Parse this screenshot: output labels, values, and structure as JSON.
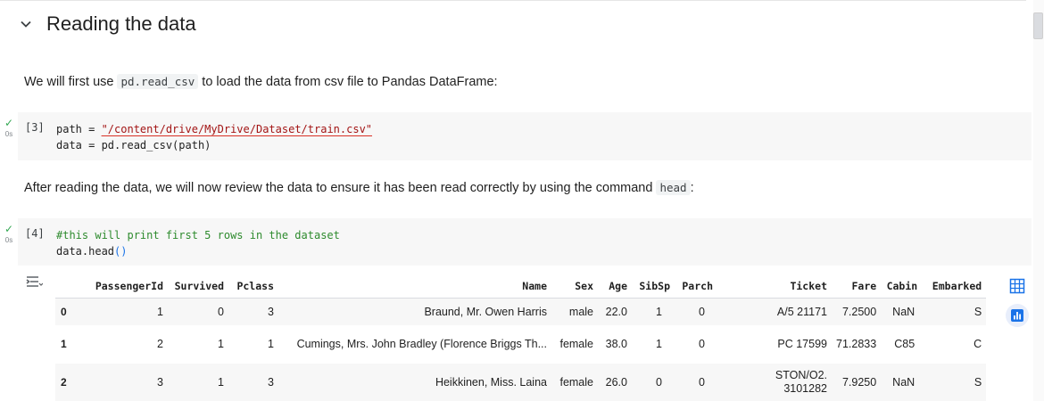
{
  "section": {
    "title": "Reading the data"
  },
  "text_cell_1": {
    "before": "We will first use ",
    "code": "pd.read_csv",
    "after": " to load the data from csv file to Pandas DataFrame:"
  },
  "cell_3": {
    "exec_count": "[3]",
    "exec_time": "0s",
    "line1_prefix": "path = ",
    "line1_string": "\"/content/drive/MyDrive/Dataset/train.csv\"",
    "line2": "data = pd.read_csv(path)"
  },
  "text_cell_2": {
    "before": "After reading the data, we will now review the data to ensure it has been read correctly by using the command ",
    "code": "head",
    "after": ":"
  },
  "cell_4": {
    "exec_count": "[4]",
    "exec_time": "0s",
    "comment": "#this will print first 5 rows in the dataset",
    "line2_prefix": "data.head",
    "line2_parens": "()"
  },
  "dataframe": {
    "columns": [
      "",
      "PassengerId",
      "Survived",
      "Pclass",
      "Name",
      "Sex",
      "Age",
      "SibSp",
      "Parch",
      "Ticket",
      "Fare",
      "Cabin",
      "Embarked"
    ],
    "rows": [
      [
        "0",
        "1",
        "0",
        "3",
        "Braund, Mr. Owen Harris",
        "male",
        "22.0",
        "1",
        "0",
        "A/5 21171",
        "7.2500",
        "NaN",
        "S"
      ],
      [
        "1",
        "2",
        "1",
        "1",
        "Cumings, Mrs. John Bradley (Florence Briggs Th...",
        "female",
        "38.0",
        "1",
        "0",
        "PC 17599",
        "71.2833",
        "C85",
        "C"
      ],
      [
        "2",
        "3",
        "1",
        "3",
        "Heikkinen, Miss. Laina",
        "female",
        "26.0",
        "0",
        "0",
        "STON/O2. 3101282",
        "7.9250",
        "NaN",
        "S"
      ]
    ]
  },
  "icons": {
    "section_toggle": "chevron-down-icon",
    "status": "check-icon",
    "output_actions": "output-actions-icon",
    "table_view": "table-icon",
    "chart_suggest": "bar-chart-icon"
  },
  "colors": {
    "check": "#34a853",
    "string": "#a31515",
    "comment": "#2e8b2e",
    "accent": "#1a73e8"
  }
}
